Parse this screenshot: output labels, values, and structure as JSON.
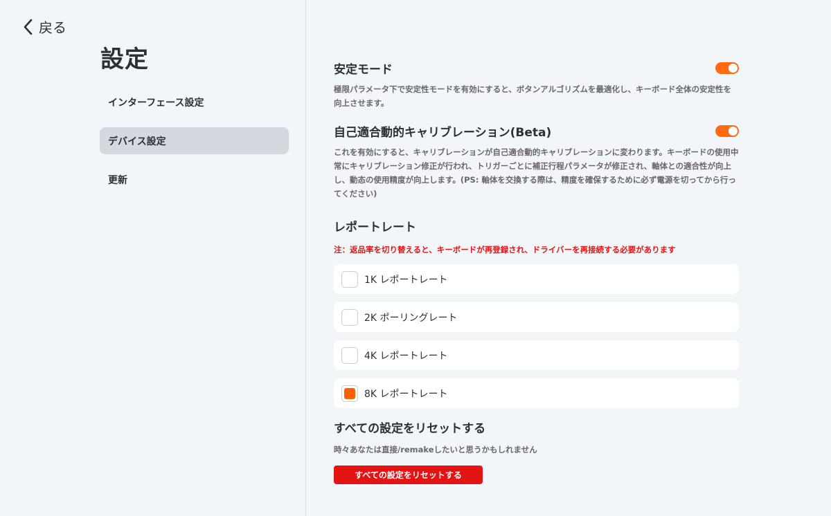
{
  "back": {
    "label": "戻る"
  },
  "page_title": "設定",
  "sidebar": {
    "items": [
      {
        "label": "インターフェース設定",
        "active": false
      },
      {
        "label": "デバイス設定",
        "active": true
      },
      {
        "label": "更新",
        "active": false
      }
    ]
  },
  "stability": {
    "title": "安定モード",
    "enabled": true,
    "description": "極限パラメータ下で安定性モードを有効にすると、ボタンアルゴリズムを最適化し、キーボード全体の安定性を向上させます。"
  },
  "calibration": {
    "title": "自己適合動的キャリブレーション(Beta)",
    "enabled": true,
    "description": "これを有効にすると、キャリブレーションが自己適合動的キャリブレーションに変わります。キーボードの使用中常にキャリブレーション修正が行われ、トリガーごとに補正行程パラメータが修正され、軸体との適合性が向上し、動态の使用精度が向上します。(PS: 軸体を交換する際は、精度を確保するために必ず電源を切ってから行ってください)"
  },
  "report_rate": {
    "title": "レポートレート",
    "warning": "注：返品率を切り替えると、キーボードが再登録され、ドライバーを再接続する必要があります",
    "options": [
      {
        "label": "1K レポートレート",
        "checked": false
      },
      {
        "label": "2K ポーリングレート",
        "checked": false
      },
      {
        "label": "4K レポートレート",
        "checked": false
      },
      {
        "label": "8K レポートレート",
        "checked": true
      }
    ]
  },
  "reset": {
    "title": "すべての設定をリセットする",
    "description": "時々あなたは直接/remakeしたいと思うかもしれません",
    "button_label": "すべての設定をリセットする"
  },
  "colors": {
    "accent": "#ff6a13",
    "danger": "#e51414",
    "sidebar_active": "#d5d8de",
    "background": "#f3f6f9"
  }
}
